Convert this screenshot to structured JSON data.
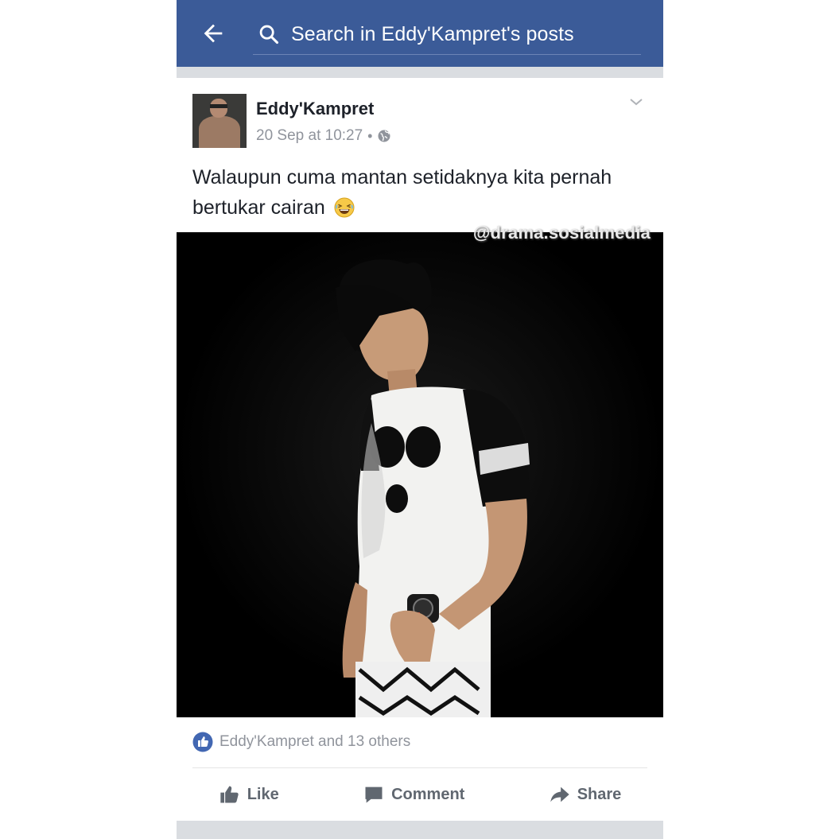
{
  "header": {
    "back_icon": "arrow-left-icon",
    "search_icon": "search-icon",
    "search_text": "Search in Eddy'Kampret's posts"
  },
  "post": {
    "author": "Eddy'Kampret",
    "timestamp": "20 Sep at 10:27",
    "separator": "•",
    "privacy_icon": "globe-icon",
    "options_icon": "chevron-down-icon",
    "text": "Walaupun cuma mantan setidaknya kita pernah bertukar cairan",
    "emoji": "laughing-emoji",
    "watermark": "@drama.sosialmedia"
  },
  "reactions": {
    "icon": "like-icon",
    "text": "Eddy'Kampret and 13 others"
  },
  "actions": {
    "like_label": "Like",
    "comment_label": "Comment",
    "share_label": "Share"
  },
  "colors": {
    "header_bg": "#3b5b98",
    "accent": "#4267b2",
    "muted_text": "#90949c",
    "action_text": "#606770"
  }
}
